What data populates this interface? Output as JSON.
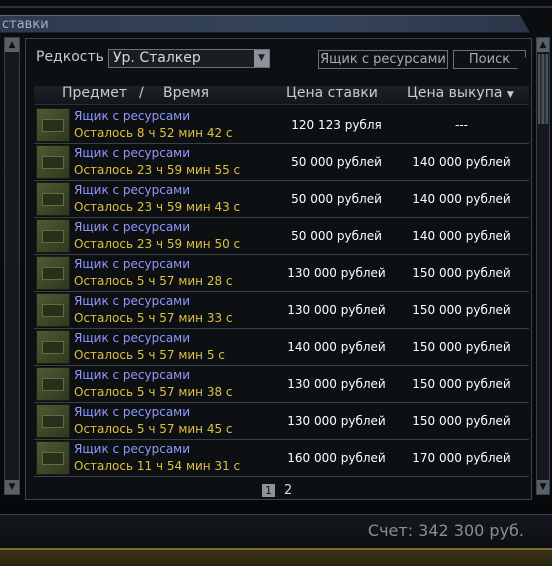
{
  "window": {
    "title": "ставки"
  },
  "filter": {
    "label": "Редкость",
    "rarity_value": "Ур. Сталкер",
    "box_button": "Ящик с ресурсами",
    "search_button": "Поиск"
  },
  "table": {
    "headers": {
      "item": "Предмет",
      "separator": "/",
      "time": "Время",
      "bid": "Цена ставки",
      "buyout": "Цена выкупа"
    },
    "rows": [
      {
        "name": "Ящик с ресурсами",
        "time": "Осталось 8 ч 52 мин 42 с",
        "bid": "120 123 рубля",
        "buyout": "---"
      },
      {
        "name": "Ящик с ресурсами",
        "time": "Осталось 23 ч 59 мин 55 с",
        "bid": "50 000 рублей",
        "buyout": "140 000 рублей"
      },
      {
        "name": "Ящик с ресурсами",
        "time": "Осталось 23 ч 59 мин 43 с",
        "bid": "50 000 рублей",
        "buyout": "140 000 рублей"
      },
      {
        "name": "Ящик с ресурсами",
        "time": "Осталось 23 ч 59 мин 50 с",
        "bid": "50 000 рублей",
        "buyout": "140 000 рублей"
      },
      {
        "name": "Ящик с ресурсами",
        "time": "Осталось 5 ч 57 мин 28 с",
        "bid": "130 000 рублей",
        "buyout": "150 000 рублей"
      },
      {
        "name": "Ящик с ресурсами",
        "time": "Осталось 5 ч 57 мин 33 с",
        "bid": "130 000 рублей",
        "buyout": "150 000 рублей"
      },
      {
        "name": "Ящик с ресурсами",
        "time": "Осталось 5 ч 57 мин 5 с",
        "bid": "140 000 рублей",
        "buyout": "150 000 рублей"
      },
      {
        "name": "Ящик с ресурсами",
        "time": "Осталось 5 ч 57 мин 38 с",
        "bid": "130 000 рублей",
        "buyout": "150 000 рублей"
      },
      {
        "name": "Ящик с ресурсами",
        "time": "Осталось 5 ч 57 мин 45 с",
        "bid": "130 000 рублей",
        "buyout": "150 000 рублей"
      },
      {
        "name": "Ящик с ресурсами",
        "time": "Осталось 11 ч 54 мин 31 с",
        "bid": "160 000 рублей",
        "buyout": "170 000 рублей"
      }
    ]
  },
  "pager": {
    "current": "1",
    "next": "2"
  },
  "footer": {
    "balance": "Счет: 342 300 руб."
  },
  "colors": {
    "item_name": "#9098ff",
    "time_left": "#e0c040",
    "price": "#ffffff"
  },
  "icons": {
    "item": "resource-box-icon",
    "sort": "sort-down-icon",
    "select": "dropdown-arrow-icon"
  }
}
